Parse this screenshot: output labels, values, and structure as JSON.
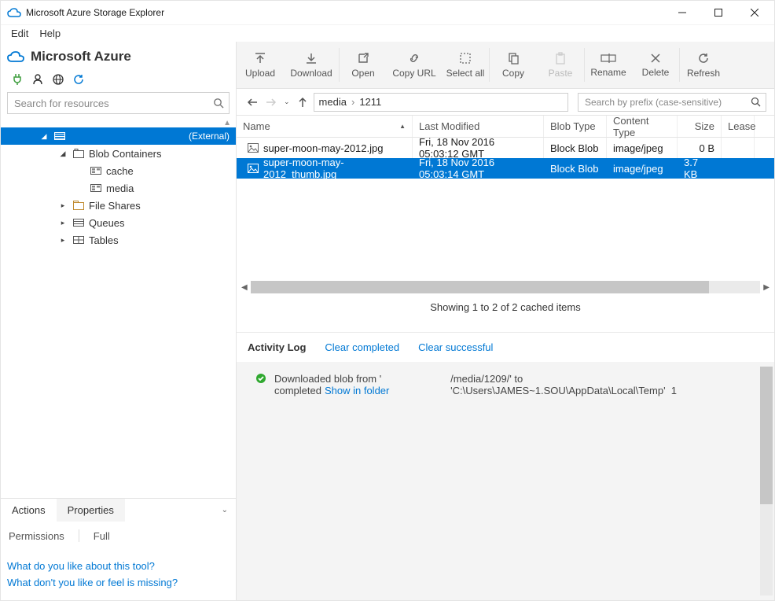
{
  "window": {
    "title": "Microsoft Azure Storage Explorer"
  },
  "menu": {
    "edit": "Edit",
    "help": "Help"
  },
  "azure_header": "Microsoft Azure",
  "search": {
    "placeholder": "Search for resources"
  },
  "tree": {
    "external_label": "(External)",
    "blob_containers": "Blob Containers",
    "cache": "cache",
    "media": "media",
    "file_shares": "File Shares",
    "queues": "Queues",
    "tables": "Tables"
  },
  "tabs": {
    "actions": "Actions",
    "properties": "Properties"
  },
  "permissions": {
    "label": "Permissions",
    "value": "Full"
  },
  "feedback": {
    "like": "What do you like about this tool?",
    "dislike": "What don't you like or feel is missing?"
  },
  "toolbar": {
    "upload": "Upload",
    "download": "Download",
    "open": "Open",
    "copy_url": "Copy URL",
    "select_all": "Select all",
    "copy": "Copy",
    "paste": "Paste",
    "rename": "Rename",
    "delete": "Delete",
    "refresh": "Refresh"
  },
  "breadcrumb": {
    "seg1": "media",
    "seg2": "1211"
  },
  "prefix_search": {
    "placeholder": "Search by prefix (case-sensitive)"
  },
  "columns": {
    "name": "Name",
    "last_modified": "Last Modified",
    "blob_type": "Blob Type",
    "content_type": "Content Type",
    "size": "Size",
    "lease": "Lease"
  },
  "rows": [
    {
      "name": "super-moon-may-2012.jpg",
      "modified": "Fri, 18 Nov 2016 05:03:12 GMT",
      "blob_type": "Block Blob",
      "content_type": "image/jpeg",
      "size": "0 B"
    },
    {
      "name": "super-moon-may-2012_thumb.jpg",
      "modified": "Fri, 18 Nov 2016 05:03:14 GMT",
      "blob_type": "Block Blob",
      "content_type": "image/jpeg",
      "size": "3.7 KB"
    }
  ],
  "caption": "Showing 1 to 2 of 2 cached items",
  "activity": {
    "header": "Activity Log",
    "clear_completed": "Clear completed",
    "clear_successful": "Clear successful",
    "msg_line1": "Downloaded blob from '",
    "msg_line2": "completed",
    "show_in_folder": "Show in folder",
    "path": "/media/1209/' to 'C:\\Users\\JAMES~1.SOU\\AppData\\Local\\Temp'",
    "count": "1"
  }
}
